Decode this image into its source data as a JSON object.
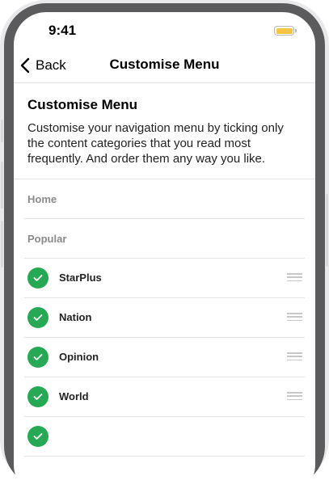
{
  "status_bar": {
    "time": "9:41",
    "battery_color": "#f6c544"
  },
  "nav": {
    "back_label": "Back",
    "title": "Customise Menu"
  },
  "intro": {
    "title": "Customise Menu",
    "text": "Customise your navigation menu by ticking only the content categories that you read most frequently. And order them any way you like."
  },
  "fixed_items": [
    {
      "label": "Home"
    },
    {
      "label": "Popular"
    }
  ],
  "categories": [
    {
      "label": "StarPlus",
      "checked": true
    },
    {
      "label": "Nation",
      "checked": true
    },
    {
      "label": "Opinion",
      "checked": true
    },
    {
      "label": "World",
      "checked": true
    },
    {
      "label": "",
      "checked": true
    }
  ],
  "colors": {
    "check_green": "#26a955",
    "divider": "#e3e3e3",
    "muted_text": "#8a8a8a"
  },
  "icons": {
    "back": "chevron-left-icon",
    "check": "checkmark-icon",
    "drag": "drag-handle-icon"
  }
}
